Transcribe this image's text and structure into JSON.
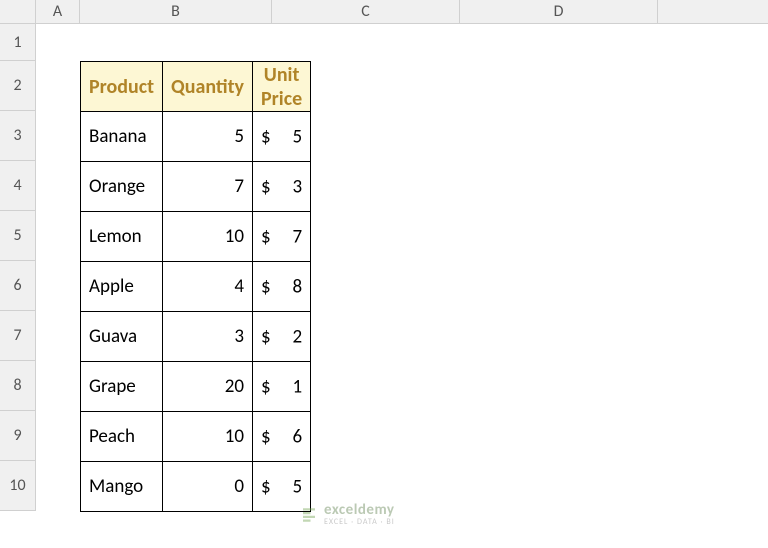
{
  "columns": {
    "A": "A",
    "B": "B",
    "C": "C",
    "D": "D"
  },
  "col_widths": {
    "A": 44,
    "B": 192,
    "C": 188,
    "D": 198
  },
  "rows": [
    "1",
    "2",
    "3",
    "4",
    "5",
    "6",
    "7",
    "8",
    "9",
    "10"
  ],
  "headers": {
    "product": "Product",
    "quantity": "Quantity",
    "unit_price": "Unit Price"
  },
  "currency_symbol": "$",
  "data": [
    {
      "product": "Banana",
      "quantity": "5",
      "price": "5"
    },
    {
      "product": "Orange",
      "quantity": "7",
      "price": "3"
    },
    {
      "product": "Lemon",
      "quantity": "10",
      "price": "7"
    },
    {
      "product": "Apple",
      "quantity": "4",
      "price": "8"
    },
    {
      "product": "Guava",
      "quantity": "3",
      "price": "2"
    },
    {
      "product": "Grape",
      "quantity": "20",
      "price": "1"
    },
    {
      "product": "Peach",
      "quantity": "10",
      "price": "6"
    },
    {
      "product": "Mango",
      "quantity": "0",
      "price": "5"
    }
  ],
  "watermark": {
    "brand": "exceldemy",
    "tagline": "EXCEL · DATA · BI"
  }
}
